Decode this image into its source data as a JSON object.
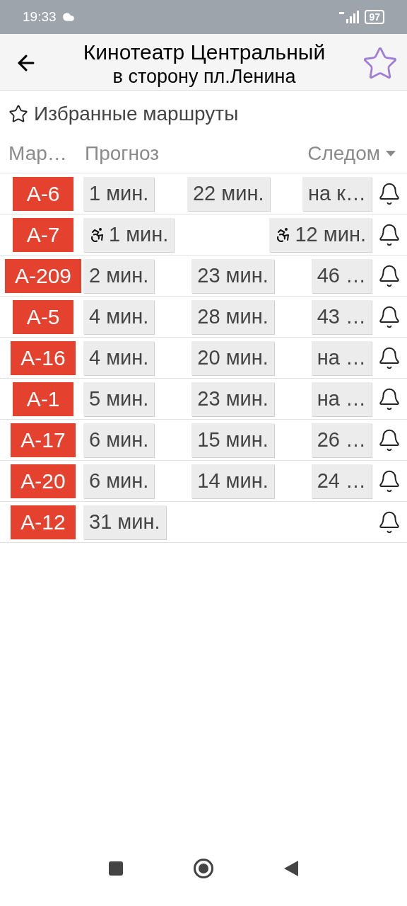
{
  "status_bar": {
    "time": "19:33",
    "battery": "97"
  },
  "header": {
    "title": "Кинотеатр Центральный",
    "subtitle": "в сторону пл.Ленина",
    "favorite": false
  },
  "favorites_link": "Избранные маршруты",
  "columns": [
    "Мар…",
    "Прогноз",
    "Следом"
  ],
  "rows": [
    {
      "route": "А-6",
      "forecasts": [
        {
          "text": "1 мин.",
          "wheelchair": false
        },
        {
          "text": "22 мин.",
          "wheelchair": false
        },
        {
          "text": "на к…",
          "wheelchair": false
        }
      ]
    },
    {
      "route": "А-7",
      "forecasts": [
        {
          "text": "1 мин.",
          "wheelchair": true
        },
        {
          "text": "12 мин.",
          "wheelchair": true
        }
      ]
    },
    {
      "route": "А-209",
      "forecasts": [
        {
          "text": "2 мин.",
          "wheelchair": false
        },
        {
          "text": "23 мин.",
          "wheelchair": false
        },
        {
          "text": "46 …",
          "wheelchair": false
        }
      ]
    },
    {
      "route": "А-5",
      "forecasts": [
        {
          "text": "4 мин.",
          "wheelchair": false
        },
        {
          "text": "28 мин.",
          "wheelchair": false
        },
        {
          "text": "43 …",
          "wheelchair": false
        }
      ]
    },
    {
      "route": "А-16",
      "forecasts": [
        {
          "text": "4 мин.",
          "wheelchair": false
        },
        {
          "text": "20 мин.",
          "wheelchair": false
        },
        {
          "text": "на …",
          "wheelchair": false
        }
      ]
    },
    {
      "route": "А-1",
      "forecasts": [
        {
          "text": "5 мин.",
          "wheelchair": false
        },
        {
          "text": "23 мин.",
          "wheelchair": false
        },
        {
          "text": "на …",
          "wheelchair": false
        }
      ]
    },
    {
      "route": "А-17",
      "forecasts": [
        {
          "text": "6 мин.",
          "wheelchair": false
        },
        {
          "text": "15 мин.",
          "wheelchair": false
        },
        {
          "text": "26 …",
          "wheelchair": false
        }
      ]
    },
    {
      "route": "А-20",
      "forecasts": [
        {
          "text": "6 мин.",
          "wheelchair": false
        },
        {
          "text": "14 мин.",
          "wheelchair": false
        },
        {
          "text": "24 …",
          "wheelchair": false
        }
      ]
    },
    {
      "route": "А-12",
      "forecasts": [
        {
          "text": "31 мин.",
          "wheelchair": false
        }
      ]
    }
  ]
}
